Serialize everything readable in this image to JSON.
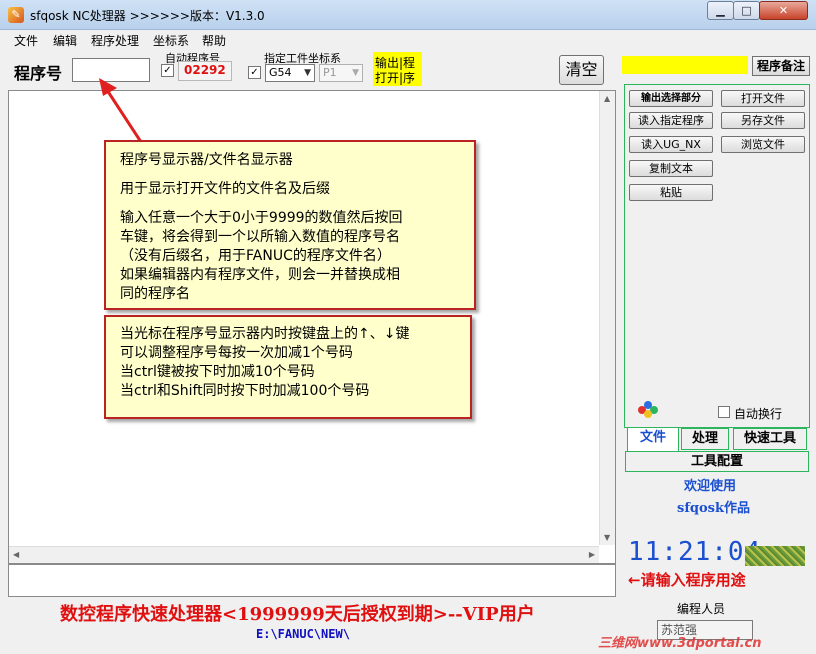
{
  "window": {
    "title": "sfqosk NC处理器 >>>>>>版本：V1.3.0",
    "app_icon_glyph": "✎",
    "min_glyph": "▁",
    "max_glyph": "□",
    "close_glyph": "✕"
  },
  "menu": [
    "文件",
    "编辑",
    "程序处理",
    "坐标系",
    "帮助"
  ],
  "toolbar": {
    "program_label": "程序号",
    "program_value": "",
    "auto_label": "自动程序号",
    "auto_check": "✓",
    "auto_number": "02292",
    "coord_label": "指定工件坐标系",
    "coord_check": "✓",
    "coord_value": "G54",
    "coord_value2": "P1",
    "output_line1": "输出|程",
    "output_line2": "打开|序",
    "clear_label": "清空"
  },
  "tooltips": {
    "t1": [
      "程序号显示器/文件名显示器",
      "用于显示打开文件的文件名及后缀",
      "输入任意一个大于0小于9999的数值然后按回",
      "车键，将会得到一个以所输入数值的程序号名",
      "（没有后缀名，用于FANUC的程序文件名）",
      "如果编辑器内有程序文件，则会一并替换成相",
      "同的程序名"
    ],
    "t2": [
      "当光标在程序号显示器内时按键盘上的↑、↓键",
      "可以调整程序号每按一次加减1个号码",
      "当ctrl键被按下时加减10个号码",
      "当ctrl和Shift同时按下时加减100个号码"
    ]
  },
  "footer": {
    "banner": "数控程序快速处理器<1999999天后授权到期>--VIP用户",
    "path": "E:\\FANUC\\NEW\\"
  },
  "right": {
    "notes_button": "程序备注",
    "buttons": {
      "output_selected": "输出选择部分",
      "open_file": "打开文件",
      "read_program": "读入指定程序",
      "save_as": "另存文件",
      "read_ugnx": "读入UG_NX",
      "browse": "浏览文件",
      "copy_text": "复制文本",
      "paste": "粘贴"
    },
    "auto_wrap": "自动换行",
    "tabs": [
      "文件",
      "处理",
      "快速工具"
    ],
    "tool_config": "工具配置",
    "welcome": "欢迎使用",
    "author": "sfqosk作品",
    "clock": "11:21:04",
    "purpose": "←请输入程序用途",
    "programmer_label": "编程人员",
    "programmer_value": "苏范强"
  },
  "watermark": "三维网www.3dportal.cn",
  "colors": {
    "accent_red": "#e01010",
    "accent_blue": "#1a4fd0",
    "highlight_yellow": "#ffff00",
    "tab_border_green": "#2db55d"
  }
}
